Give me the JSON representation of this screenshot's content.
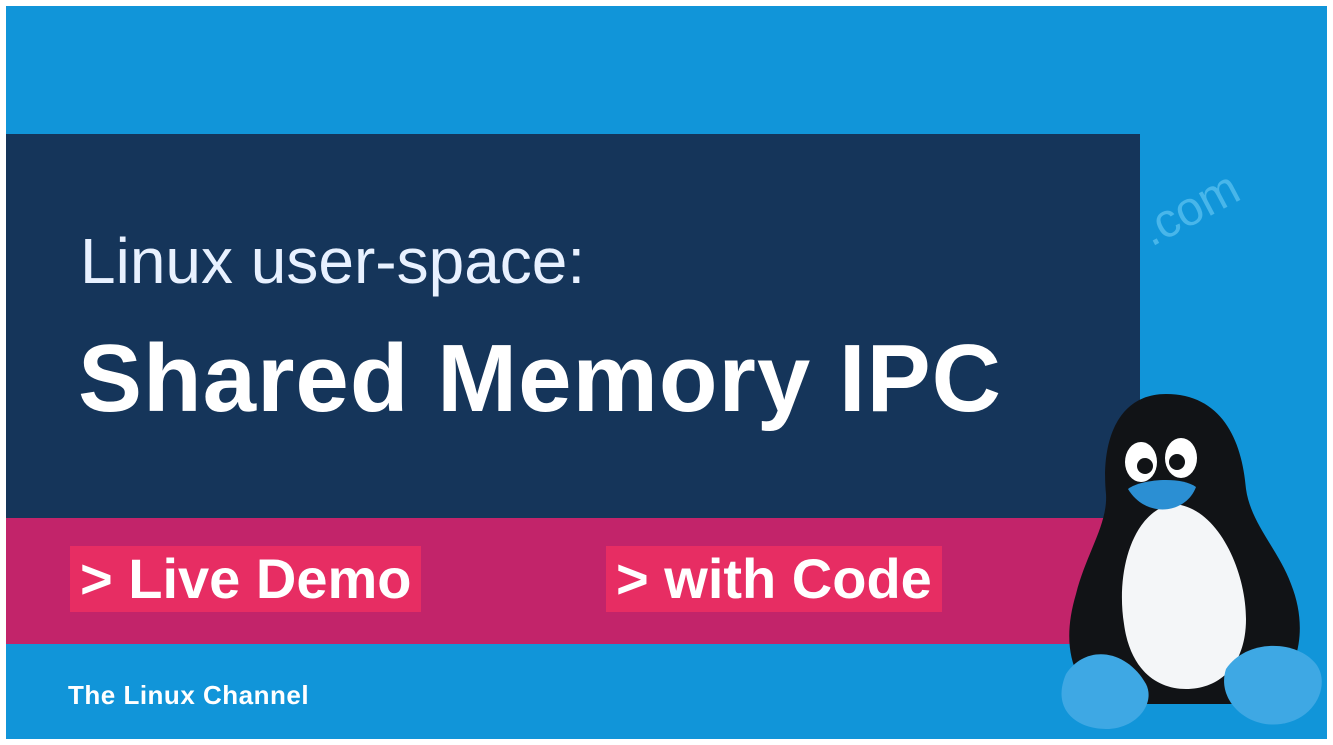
{
  "thumbnail": {
    "title_line1": "Linux user-space:",
    "title_line2": "Shared Memory IPC",
    "tags": [
      "> Live Demo",
      "> with Code"
    ],
    "channel_name": "The Linux Channel",
    "watermark": ".com",
    "mascot_icon": "tux-penguin-icon"
  },
  "colors": {
    "background": "#1195d9",
    "title_panel": "#15355a",
    "band": "#c2246a",
    "tag": "#e72d63",
    "text": "#ffffff"
  }
}
